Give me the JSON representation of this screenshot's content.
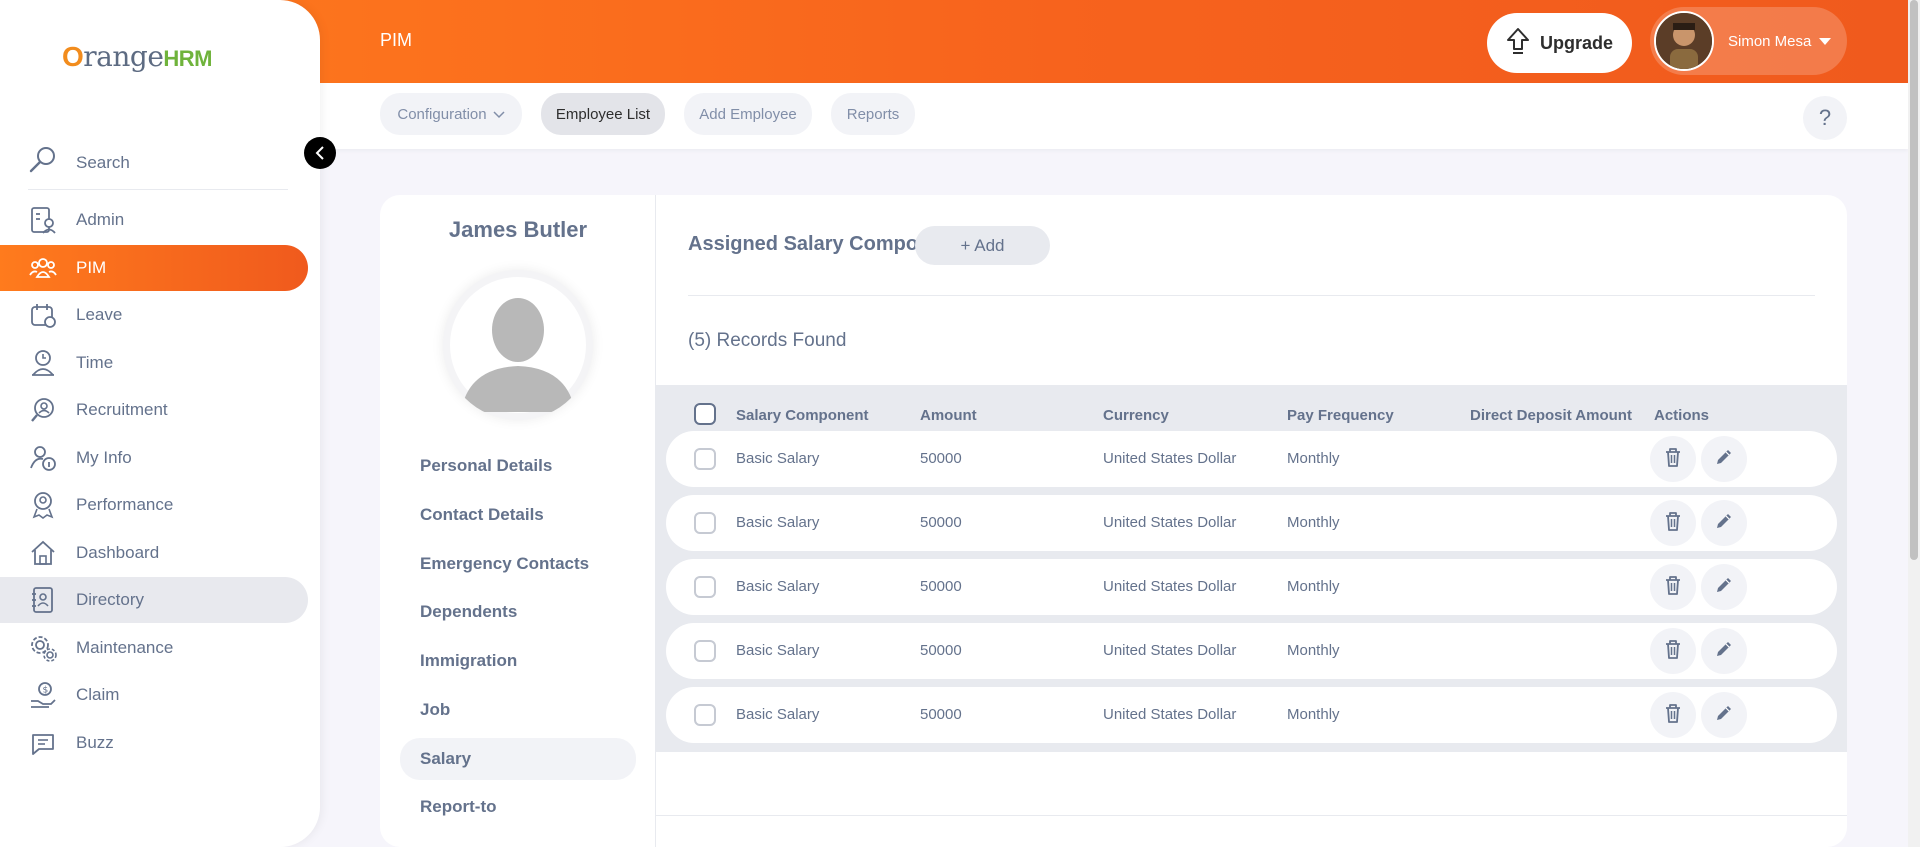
{
  "header": {
    "module": "PIM",
    "upgrade_label": "Upgrade",
    "user_name": "Simon Mesa"
  },
  "subnav": {
    "tabs": [
      {
        "label": "Configuration",
        "has_dropdown": true
      },
      {
        "label": "Employee List",
        "active": true
      },
      {
        "label": "Add Employee"
      },
      {
        "label": "Reports"
      }
    ],
    "help_label": "?"
  },
  "sidebar": {
    "logo": {
      "o": "O",
      "range": "range",
      "hrm": "HRM"
    },
    "search_label": "Search",
    "items": [
      {
        "label": "Admin",
        "icon": "admin-icon"
      },
      {
        "label": "PIM",
        "icon": "pim-icon",
        "active": true
      },
      {
        "label": "Leave",
        "icon": "leave-icon"
      },
      {
        "label": "Time",
        "icon": "time-icon"
      },
      {
        "label": "Recruitment",
        "icon": "recruitment-icon"
      },
      {
        "label": "My Info",
        "icon": "my-info-icon"
      },
      {
        "label": "Performance",
        "icon": "performance-icon"
      },
      {
        "label": "Dashboard",
        "icon": "dashboard-icon"
      },
      {
        "label": "Directory",
        "icon": "directory-icon",
        "hovered": true
      },
      {
        "label": "Maintenance",
        "icon": "maintenance-icon"
      },
      {
        "label": "Claim",
        "icon": "claim-icon"
      },
      {
        "label": "Buzz",
        "icon": "buzz-icon"
      }
    ]
  },
  "profile": {
    "employee_name": "James Butler",
    "nav": [
      {
        "label": "Personal Details"
      },
      {
        "label": "Contact Details"
      },
      {
        "label": "Emergency Contacts"
      },
      {
        "label": "Dependents"
      },
      {
        "label": "Immigration"
      },
      {
        "label": "Job"
      },
      {
        "label": "Salary",
        "active": true
      },
      {
        "label": "Report-to"
      }
    ]
  },
  "salary": {
    "title": "Assigned Salary Components",
    "add_label": "+ Add",
    "records_label": "(5) Records Found",
    "columns": [
      "Salary Component",
      "Amount",
      "Currency",
      "Pay Frequency",
      "Direct Deposit Amount",
      "Actions"
    ],
    "rows": [
      {
        "component": "Basic Salary",
        "amount": "50000",
        "currency": "United States Dollar",
        "frequency": "Monthly",
        "deposit": ""
      },
      {
        "component": "Basic Salary",
        "amount": "50000",
        "currency": "United States Dollar",
        "frequency": "Monthly",
        "deposit": ""
      },
      {
        "component": "Basic Salary",
        "amount": "50000",
        "currency": "United States Dollar",
        "frequency": "Monthly",
        "deposit": ""
      },
      {
        "component": "Basic Salary",
        "amount": "50000",
        "currency": "United States Dollar",
        "frequency": "Monthly",
        "deposit": ""
      },
      {
        "component": "Basic Salary",
        "amount": "50000",
        "currency": "United States Dollar",
        "frequency": "Monthly",
        "deposit": ""
      }
    ]
  },
  "colors": {
    "brand_orange": "#ff7b1d",
    "brand_orange_dark": "#f05a1d",
    "text_primary": "#64728c",
    "logo_green": "#6fb33b"
  }
}
